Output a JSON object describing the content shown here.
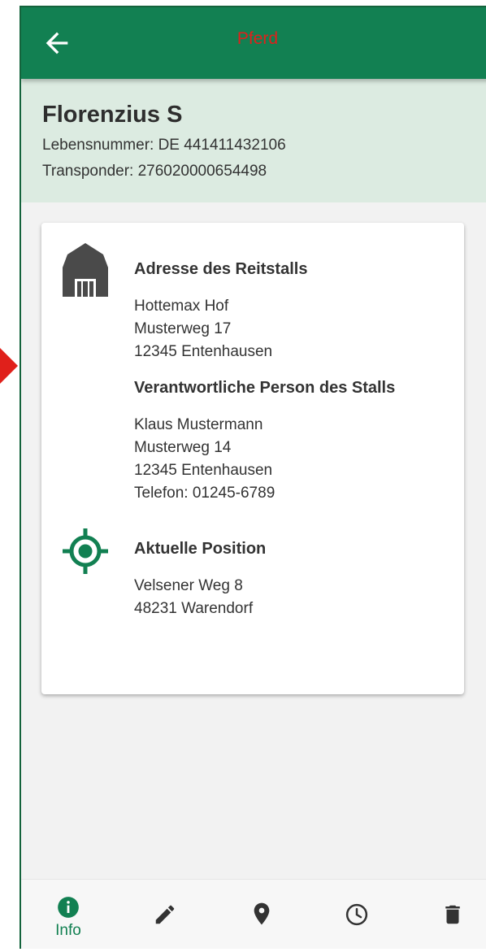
{
  "appbar": {
    "title": "Pferd"
  },
  "horse": {
    "name": "Florenzius S",
    "lebensnummer": "Lebensnummer: DE 441411432106",
    "transponder": "Transponder: 276020000654498"
  },
  "stable": {
    "title": "Adresse des Reitstalls",
    "lines": [
      "Hottemax Hof",
      "Musterweg 17",
      "12345 Entenhausen"
    ]
  },
  "responsible": {
    "title": "Verantwortliche Person des Stalls",
    "lines": [
      "Klaus Mustermann",
      "Musterweg 14",
      "12345 Entenhausen",
      "Telefon: 01245-6789"
    ]
  },
  "position": {
    "title": "Aktuelle Position",
    "lines": [
      "Velsener Weg 8",
      "48231 Warendorf"
    ]
  },
  "bottom_nav": {
    "items": [
      {
        "icon": "info-icon",
        "label": "Info",
        "active": true
      },
      {
        "icon": "pencil-icon",
        "label": ""
      },
      {
        "icon": "location-pin-icon",
        "label": ""
      },
      {
        "icon": "clock-icon",
        "label": ""
      },
      {
        "icon": "trash-icon",
        "label": ""
      }
    ]
  },
  "colors": {
    "primary": "#128052",
    "title_red": "#e0201b",
    "header_bg": "#dcebe1"
  }
}
